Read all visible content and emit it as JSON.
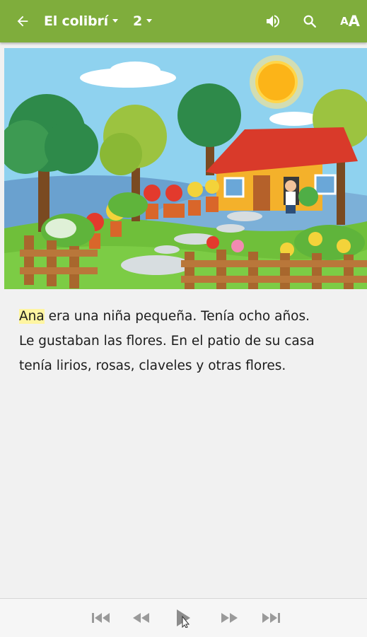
{
  "header": {
    "book_title": "El colibrí",
    "page_number": "2"
  },
  "icons": {
    "back": "arrow-left-icon",
    "audio": "speaker-icon",
    "search": "search-icon",
    "font_size": "font-size-icon",
    "font_size_label_small": "A",
    "font_size_label_large": "A"
  },
  "story": {
    "highlighted_word": "Ana",
    "line1_rest": " era una niña pequeña. Tenía ocho años.",
    "line2": "Le gustaban las flores. En el patio de su casa",
    "line3": "tenía lirios, rosas, claveles y otras flores."
  },
  "player": {
    "buttons": [
      "skip-to-start",
      "rewind",
      "play",
      "fast-forward",
      "skip-to-end"
    ]
  },
  "colors": {
    "header_bg": "#7fad3c",
    "highlight": "#fff5a1",
    "page_bg": "#f1f1f1"
  }
}
